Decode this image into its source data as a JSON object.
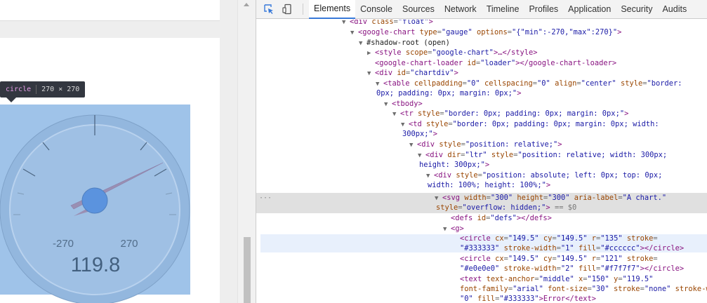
{
  "tooltip": {
    "tag": "circle",
    "size": "270 × 270"
  },
  "gauge": {
    "min_label": "-270",
    "max_label": "270",
    "value_label": "119.8",
    "face_color": "#cfd8e3",
    "needle_color": "#dc3912",
    "hub_color": "#4684ee"
  },
  "devtools": {
    "tabs": [
      "Elements",
      "Console",
      "Sources",
      "Network",
      "Timeline",
      "Profiles",
      "Application",
      "Security",
      "Audits"
    ],
    "active_tab": "Elements",
    "dom": {
      "l1": {
        "open": "<",
        "tag": "div",
        "a1": "class",
        "v1": "\"float\"",
        "close": ">"
      },
      "l2": {
        "tag": "google-chart",
        "a1": "type",
        "v1": "\"gauge\"",
        "a2": "options",
        "v2": "\"{\"min\":-270,\"max\":270}\""
      },
      "l3": {
        "text": "#shadow-root (open)"
      },
      "l4": {
        "tag": "style",
        "a1": "scope",
        "v1": "\"google-chart\"",
        "rest": ">…</style>"
      },
      "l5": {
        "tag": "google-chart-loader",
        "a1": "id",
        "v1": "\"loader\"",
        "rest": "></google-chart-loader>"
      },
      "l6": {
        "tag": "div",
        "a1": "id",
        "v1": "\"chartdiv\""
      },
      "l7": {
        "tag": "table",
        "a1": "cellpadding",
        "v1": "\"0\"",
        "a2": "cellspacing",
        "v2": "\"0\"",
        "a3": "align",
        "v3": "\"center\"",
        "a4": "style",
        "v4a": "\"border:",
        "v4b": "0px; padding: 0px; margin: 0px;\""
      },
      "l8": {
        "tag": "tbody"
      },
      "l9": {
        "tag": "tr",
        "a1": "style",
        "v1": "\"border: 0px; padding: 0px; margin: 0px;\""
      },
      "l10": {
        "tag": "td",
        "a1": "style",
        "v1a": "\"border: 0px; padding: 0px; margin: 0px; width:",
        "v1b": "300px;\""
      },
      "l11": {
        "tag": "div",
        "a1": "style",
        "v1": "\"position: relative;\""
      },
      "l12": {
        "tag": "div",
        "a1": "dir",
        "v1": "\"ltr\"",
        "a2": "style",
        "v2a": "\"position: relative; width: 300px;",
        "v2b": "height: 300px;\""
      },
      "l13": {
        "tag": "div",
        "a1": "style",
        "v1a": "\"position: absolute; left: 0px; top: 0px;",
        "v1b": "width: 100%; height: 100%;\""
      },
      "l14": {
        "tag": "svg",
        "a1": "width",
        "v1": "\"300\"",
        "a2": "height",
        "v2": "\"300\"",
        "a3": "aria-label",
        "v3": "\"A chart.\"",
        "a4": "style",
        "v4": "\"overflow: hidden;\"",
        "marker": "== $0"
      },
      "l15": {
        "tag": "defs",
        "a1": "id",
        "v1": "\"defs\"",
        "rest": "></defs>"
      },
      "l16": {
        "tag": "g"
      },
      "l17": {
        "tag": "circle",
        "a1": "cx",
        "v1": "\"149.5\"",
        "a2": "cy",
        "v2": "\"149.5\"",
        "a3": "r",
        "v3": "\"135\"",
        "a4": "stroke",
        "v4": "\"#333333\"",
        "a5": "stroke-width",
        "v5": "\"1\"",
        "a6": "fill",
        "v6": "\"#cccccc\"",
        "rest": "></circle>"
      },
      "l18": {
        "tag": "circle",
        "a1": "cx",
        "v1": "\"149.5\"",
        "a2": "cy",
        "v2": "\"149.5\"",
        "a3": "r",
        "v3": "\"121\"",
        "a4": "stroke",
        "v4": "\"#e0e0e0\"",
        "a5": "stroke-width",
        "v5": "\"2\"",
        "a6": "fill",
        "v6": "\"#f7f7f7\"",
        "rest": "></circle>"
      },
      "l19": {
        "tag": "text",
        "a1": "text-anchor",
        "v1": "\"middle\"",
        "a2": "x",
        "v2": "\"150\"",
        "a3": "y",
        "v3": "\"119.5\"",
        "a4": "font-family",
        "v4": "\"arial\"",
        "a5": "font-size",
        "v5": "\"30\"",
        "a6": "stroke",
        "v6": "\"none\"",
        "a7": "stroke-width",
        "v7": "\"0\"",
        "a8": "fill",
        "v8": "\"#333333\"",
        "rest": ">Error</text>"
      }
    }
  }
}
